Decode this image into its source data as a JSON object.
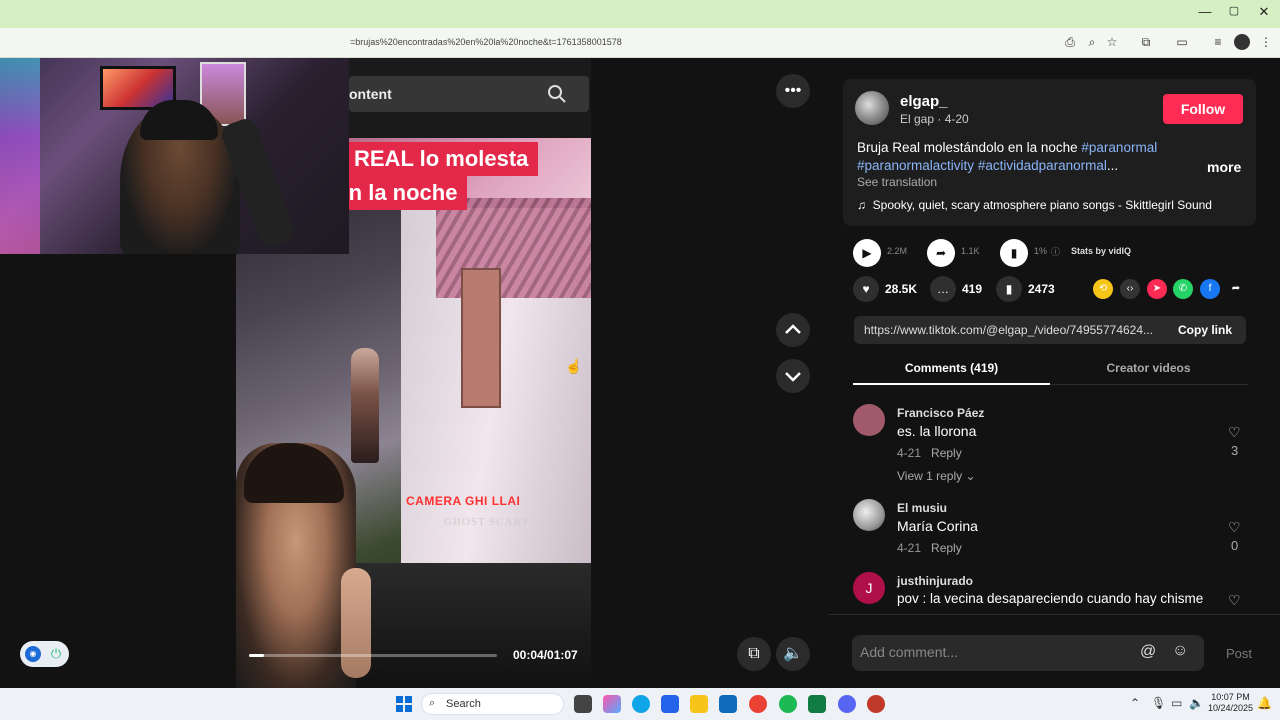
{
  "browser": {
    "url": "=brujas%20encontradas%20en%20la%20noche&t=1761358001578",
    "window_controls": {
      "minimize": "—",
      "maximize": "▢",
      "close": "✕"
    }
  },
  "video": {
    "search_placeholder": "ontent",
    "caption_line1": "REAL lo molesta",
    "caption_line2": "En la noche",
    "cctv_label": "CAMERA GHI LLAI",
    "cctv_watermark": "GHOST SCARY",
    "timecode": "00:04/01:07",
    "progress_fraction": 0.06
  },
  "post": {
    "username": "elgap_",
    "subline": "El gap · 4-20",
    "follow_label": "Follow",
    "description_text": "Bruja Real molestándolo en la noche ",
    "tags": [
      "#paranormal",
      "#paranormalactivity",
      "#actividadparanormal"
    ],
    "more_label": "more",
    "see_translation": "See translation",
    "sound_icon": "♫",
    "sound": "Spooky, quiet, scary atmosphere piano songs - Skittlegirl Sound"
  },
  "stats": {
    "views": "2.2M",
    "shares": "1.1K",
    "percent": "1%",
    "vidiq_label": "Stats by vidIQ"
  },
  "actions": {
    "likes": "28.5K",
    "comments": "419",
    "saves": "2473"
  },
  "link": {
    "url": "https://www.tiktok.com/@elgap_/video/74955774624...",
    "copy_label": "Copy link"
  },
  "tabs": {
    "comments": "Comments (419)",
    "creator": "Creator videos"
  },
  "comments": [
    {
      "name": "Francisco Páez",
      "text": "es. la llorona",
      "date": "4-21",
      "reply": "Reply",
      "likes": "3",
      "view_replies": "View 1 reply ⌄",
      "avatar_color": "#a05a6a"
    },
    {
      "name": "El musiu",
      "text": "María Corina",
      "date": "4-21",
      "reply": "Reply",
      "likes": "0",
      "avatar_color": "#d8d8d8"
    },
    {
      "name": "justhinjurado",
      "text": "pov : la vecina desapareciendo cuando hay chisme",
      "avatar_letter": "J",
      "avatar_color": "#b0104a"
    }
  ],
  "add_comment": {
    "placeholder": "Add comment...",
    "post_label": "Post"
  },
  "taskbar": {
    "search_label": "Search",
    "time": "10:07 PM",
    "date": "10/24/2025"
  },
  "colors": {
    "accent": "#fe2c55",
    "hashtag": "#8ab4f8",
    "panel_bg": "#121212",
    "titlebar": "#d6f0c4"
  }
}
